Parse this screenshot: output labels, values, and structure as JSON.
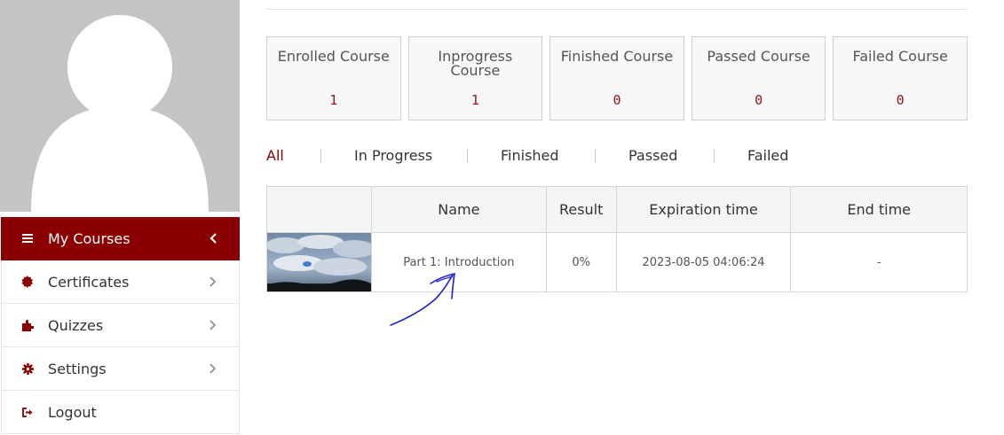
{
  "sidebar": {
    "menu": [
      {
        "label": "My Courses",
        "icon": "list-icon",
        "active": true
      },
      {
        "label": "Certificates",
        "icon": "certificate-icon",
        "active": false
      },
      {
        "label": "Quizzes",
        "icon": "puzzle-icon",
        "active": false
      },
      {
        "label": "Settings",
        "icon": "gear-icon",
        "active": false
      },
      {
        "label": "Logout",
        "icon": "logout-icon",
        "active": false
      }
    ]
  },
  "stats": [
    {
      "title": "Enrolled Course",
      "value": "1"
    },
    {
      "title": "Inprogress Course",
      "value": "1"
    },
    {
      "title": "Finished Course",
      "value": "0"
    },
    {
      "title": "Passed Course",
      "value": "0"
    },
    {
      "title": "Failed Course",
      "value": "0"
    }
  ],
  "tabs": [
    "All",
    "In Progress",
    "Finished",
    "Passed",
    "Failed"
  ],
  "table": {
    "headers": [
      "",
      "Name",
      "Result",
      "Expiration time",
      "End time"
    ],
    "rows": [
      {
        "name": "Part 1: Introduction",
        "result": "0%",
        "expiration": "2023-08-05 04:06:24",
        "end": "-"
      }
    ]
  },
  "colors": {
    "accent": "#8a0000",
    "stat_value": "#9b1010",
    "annotation": "#1f1fd0"
  }
}
